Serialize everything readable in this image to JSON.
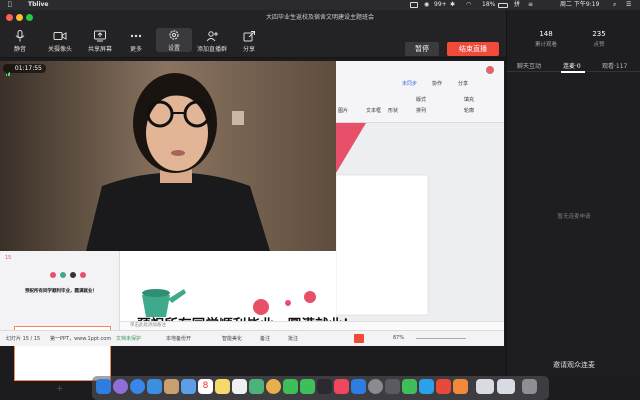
{
  "menubar": {
    "app_name": "Tblive",
    "badge": "99+",
    "battery": "18%",
    "datetime": "周二 下午9:19"
  },
  "window": {
    "title": "大四毕业生返校及宿舍文明建设主题班会"
  },
  "toolbar": {
    "buttons": [
      {
        "label": "静音",
        "icon": "microphone-icon"
      },
      {
        "label": "关摄像头",
        "icon": "camera-icon"
      },
      {
        "label": "共享屏幕",
        "icon": "share-screen-icon"
      },
      {
        "label": "更多",
        "icon": "more-icon"
      },
      {
        "label": "设置",
        "icon": "gear-icon"
      },
      {
        "label": "添加直播群",
        "icon": "add-group-icon"
      },
      {
        "label": "分享",
        "icon": "share-icon"
      }
    ],
    "pause_label": "暂停",
    "end_label": "结束直播"
  },
  "stats": {
    "views_value": "148",
    "views_label": "累计观看",
    "likes_value": "235",
    "likes_label": "点赞"
  },
  "right_tabs": [
    {
      "label": "聊天互动"
    },
    {
      "label": "连麦·0"
    },
    {
      "label": "观看·117"
    }
  ],
  "connect_empty": "暂无连麦申请",
  "invite_label": "邀请观众连麦",
  "camera": {
    "timer": "01:17:55"
  },
  "ppt": {
    "toolbar": {
      "undo_sync": "未同步",
      "collab": "协作",
      "share": "分享",
      "layout": "版式",
      "fill": "填充",
      "arrange": "排列",
      "outline": "轮廓",
      "textbox": "文本框",
      "shape": "形状",
      "image": "图片"
    },
    "slide_text": "预祝所有同学顺利毕业，圆满就业！",
    "thumb_text": "预祝所有同学顺利毕业，圆满就业！",
    "notes_placeholder": "单击此处添加备注",
    "status": {
      "slide_info": "幻灯片 15 / 15",
      "theme": "第一PPT，www.1ppt.com",
      "doc_status": "文档未保护",
      "cloud": "本地备份开",
      "smart": "智能美化",
      "notes": "备注",
      "comment": "批注",
      "zoom": "87%"
    },
    "thumb_index": "15"
  },
  "colors": {
    "accent_red": "#f04a3a",
    "slide_pink": "#e8506a",
    "slide_teal": "#3fa98b"
  }
}
